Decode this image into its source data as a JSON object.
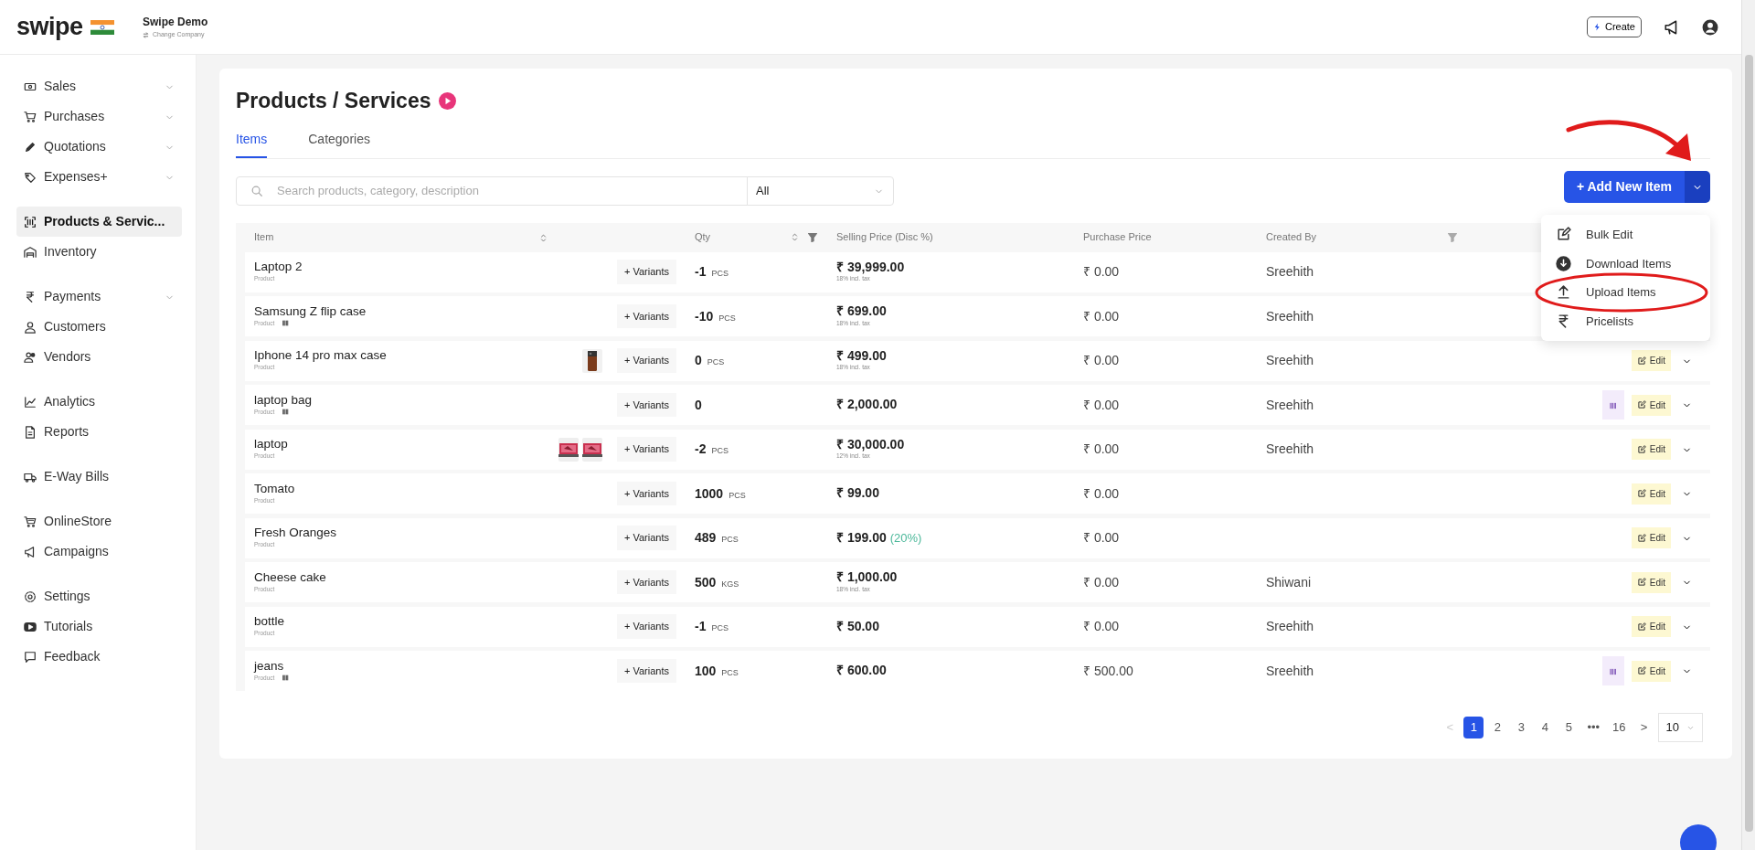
{
  "header": {
    "logo": "swipe",
    "company": "Swipe Demo",
    "change_company": "Change Company",
    "create_button": "Create"
  },
  "sidebar": {
    "groups": [
      [
        {
          "label": "Sales",
          "chevron": true,
          "selected": false
        },
        {
          "label": "Purchases",
          "chevron": true,
          "selected": false
        },
        {
          "label": "Quotations",
          "chevron": true,
          "selected": false
        },
        {
          "label": "Expenses+",
          "chevron": true,
          "selected": false
        }
      ],
      [
        {
          "label": "Products & Servic...",
          "chevron": false,
          "selected": true
        },
        {
          "label": "Inventory",
          "chevron": false,
          "selected": false
        }
      ],
      [
        {
          "label": "Payments",
          "chevron": true,
          "selected": false
        },
        {
          "label": "Customers",
          "chevron": false,
          "selected": false
        },
        {
          "label": "Vendors",
          "chevron": false,
          "selected": false
        }
      ],
      [
        {
          "label": "Analytics",
          "chevron": false,
          "selected": false
        },
        {
          "label": "Reports",
          "chevron": false,
          "selected": false
        }
      ],
      [
        {
          "label": "E-Way Bills",
          "chevron": false,
          "selected": false
        }
      ],
      [
        {
          "label": "OnlineStore",
          "chevron": false,
          "selected": false
        },
        {
          "label": "Campaigns",
          "chevron": false,
          "selected": false
        }
      ],
      [
        {
          "label": "Settings",
          "chevron": false,
          "selected": false
        },
        {
          "label": "Tutorials",
          "chevron": false,
          "selected": false
        },
        {
          "label": "Feedback",
          "chevron": false,
          "selected": false
        }
      ]
    ]
  },
  "page": {
    "title": "Products / Services",
    "tabs": [
      {
        "label": "Items",
        "selected": true
      },
      {
        "label": "Categories",
        "selected": false
      }
    ],
    "search": {
      "placeholder": "Search products, category, description"
    },
    "category_select": {
      "value": "All"
    },
    "add_button": "+ Add New Item",
    "add_menu": [
      {
        "label": "Bulk Edit"
      },
      {
        "label": "Download Items"
      },
      {
        "label": "Upload Items"
      },
      {
        "label": "Pricelists"
      }
    ],
    "table": {
      "columns": [
        "Item",
        "Qty",
        "Selling Price (Disc %)",
        "Purchase Price",
        "Created By"
      ],
      "rows": [
        {
          "name": "Laptop 2",
          "type": "Product",
          "barcode": false,
          "thumbnails": [],
          "variants": "+ Variants",
          "qty": "-1",
          "unit": "PCS",
          "price": "₹ 39,999.00",
          "tax": "18% incl. tax",
          "purchase": "₹ 0.00",
          "created_by": "Sreehith",
          "barcode_button": false
        },
        {
          "name": "Samsung Z flip case",
          "type": "Product",
          "barcode": true,
          "thumbnails": [],
          "variants": "+ Variants",
          "qty": "-10",
          "unit": "PCS",
          "price": "₹ 699.00",
          "tax": "18% incl. tax",
          "purchase": "₹ 0.00",
          "created_by": "Sreehith",
          "barcode_button": false
        },
        {
          "name": "Iphone 14 pro max case",
          "type": "Product",
          "barcode": false,
          "variants": "+ Variants",
          "qty": "0",
          "unit": "PCS",
          "price": "₹ 499.00",
          "tax": "18% incl. tax",
          "purchase": "₹ 0.00",
          "created_by": "Sreehith",
          "barcode_button": false,
          "edit": "Edit"
        },
        {
          "name": "laptop bag",
          "type": "Product",
          "barcode": true,
          "thumbnails": [],
          "variants": "+ Variants",
          "qty": "0",
          "price": "₹ 2,000.00",
          "purchase": "₹ 0.00",
          "created_by": "Sreehith",
          "barcode_button": true,
          "edit": "Edit"
        },
        {
          "name": "laptop",
          "type": "Product",
          "barcode": false,
          "variants": "+ Variants",
          "qty": "-2",
          "unit": "PCS",
          "price": "₹ 30,000.00",
          "tax": "12% incl. tax",
          "purchase": "₹ 0.00",
          "created_by": "Sreehith",
          "barcode_button": false,
          "edit": "Edit"
        },
        {
          "name": "Tomato",
          "type": "Product",
          "barcode": false,
          "thumbnails": [],
          "variants": "+ Variants",
          "qty": "1000",
          "unit": "PCS",
          "price": "₹ 99.00",
          "purchase": "₹ 0.00",
          "barcode_button": false,
          "edit": "Edit"
        },
        {
          "name": "Fresh Oranges",
          "type": "Product",
          "barcode": false,
          "thumbnails": [],
          "variants": "+ Variants",
          "qty": "489",
          "unit": "PCS",
          "price": "₹ 199.00",
          "discount": "(20%)",
          "purchase": "₹ 0.00",
          "barcode_button": false,
          "edit": "Edit"
        },
        {
          "name": "Cheese cake",
          "type": "Product",
          "barcode": false,
          "thumbnails": [],
          "variants": "+ Variants",
          "qty": "500",
          "unit": "KGS",
          "price": "₹ 1,000.00",
          "tax": "18% incl. tax",
          "purchase": "₹ 0.00",
          "created_by": "Shiwani",
          "barcode_button": false,
          "edit": "Edit"
        },
        {
          "name": "bottle",
          "type": "Product",
          "barcode": false,
          "thumbnails": [],
          "variants": "+ Variants",
          "qty": "-1",
          "unit": "PCS",
          "price": "₹ 50.00",
          "purchase": "₹ 0.00",
          "created_by": "Sreehith",
          "barcode_button": false,
          "edit": "Edit"
        },
        {
          "name": "jeans",
          "type": "Product",
          "barcode": true,
          "thumbnails": [],
          "variants": "+ Variants",
          "qty": "100",
          "unit": "PCS",
          "price": "₹ 600.00",
          "purchase": "₹ 500.00",
          "created_by": "Sreehith",
          "barcode_button": true,
          "edit": "Edit"
        }
      ]
    },
    "pagination": {
      "prev": "<",
      "pages": [
        {
          "label": "1",
          "selected": true
        },
        {
          "label": "2",
          "selected": false
        },
        {
          "label": "3",
          "selected": false
        },
        {
          "label": "4",
          "selected": false
        },
        {
          "label": "5",
          "selected": false
        },
        {
          "label": "•••",
          "selected": false
        },
        {
          "label": "16",
          "selected": false
        }
      ],
      "next": ">",
      "page_size": "10"
    }
  }
}
